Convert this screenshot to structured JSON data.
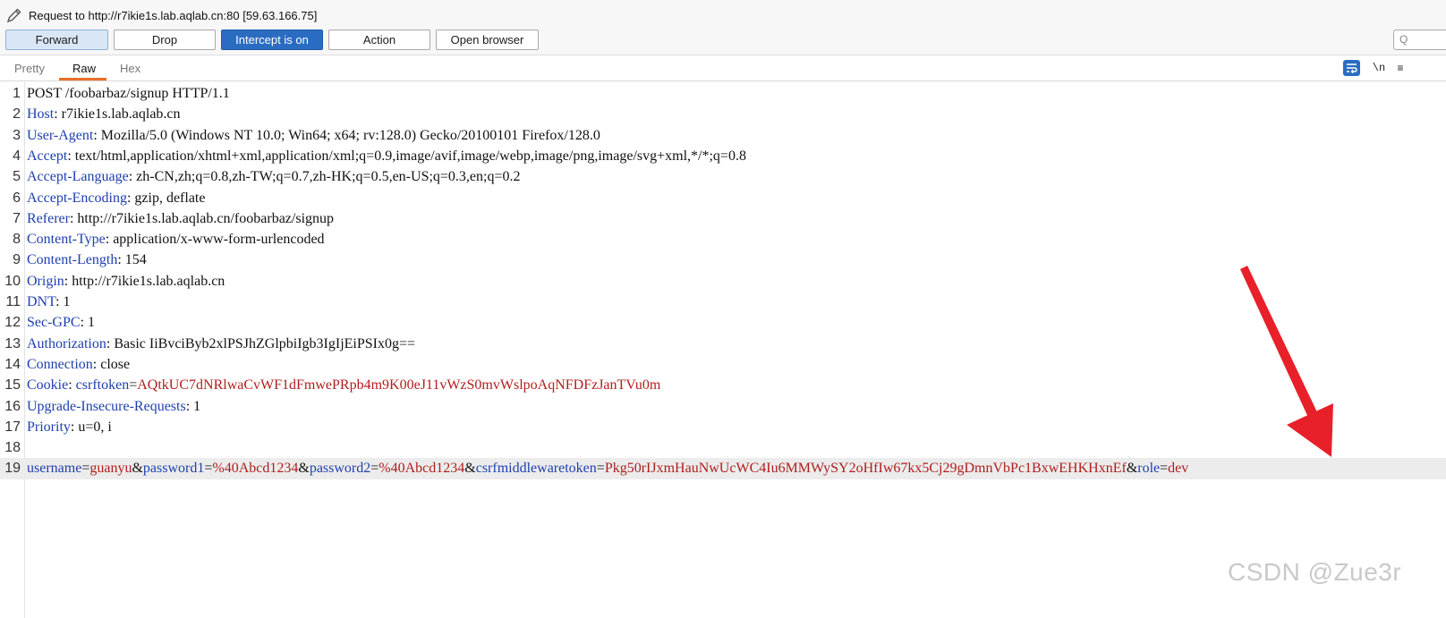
{
  "header": {
    "request_label": "Request to http://r7ikie1s.lab.aqlab.cn:80  [59.63.166.75]"
  },
  "toolbar": {
    "forward": "Forward",
    "drop": "Drop",
    "intercept": "Intercept is on",
    "action": "Action",
    "open_browser": "Open browser",
    "search_stub": "Q"
  },
  "tabs": {
    "pretty": "Pretty",
    "raw": "Raw",
    "hex": "Hex",
    "newline_toggle": "\\n",
    "menu": "≡"
  },
  "request": {
    "lines": [
      {
        "n": "1",
        "parts": [
          {
            "t": "POST /foobarbaz/signup HTTP/1.1",
            "c": "p"
          }
        ]
      },
      {
        "n": "2",
        "parts": [
          {
            "t": "Host",
            "c": "k"
          },
          {
            "t": ": r7ikie1s.lab.aqlab.cn",
            "c": "p"
          }
        ]
      },
      {
        "n": "3",
        "parts": [
          {
            "t": "User-Agent",
            "c": "k"
          },
          {
            "t": ": Mozilla/5.0 (Windows NT 10.0; Win64; x64; rv:128.0) Gecko/20100101 Firefox/128.0",
            "c": "p"
          }
        ]
      },
      {
        "n": "4",
        "parts": [
          {
            "t": "Accept",
            "c": "k"
          },
          {
            "t": ": text/html,application/xhtml+xml,application/xml;q=0.9,image/avif,image/webp,image/png,image/svg+xml,*/*;q=0.8",
            "c": "p"
          }
        ]
      },
      {
        "n": "5",
        "parts": [
          {
            "t": "Accept-Language",
            "c": "k"
          },
          {
            "t": ": zh-CN,zh;q=0.8,zh-TW;q=0.7,zh-HK;q=0.5,en-US;q=0.3,en;q=0.2",
            "c": "p"
          }
        ]
      },
      {
        "n": "6",
        "parts": [
          {
            "t": "Accept-Encoding",
            "c": "k"
          },
          {
            "t": ": gzip, deflate",
            "c": "p"
          }
        ]
      },
      {
        "n": "7",
        "parts": [
          {
            "t": "Referer",
            "c": "k"
          },
          {
            "t": ": http://r7ikie1s.lab.aqlab.cn/foobarbaz/signup",
            "c": "p"
          }
        ]
      },
      {
        "n": "8",
        "parts": [
          {
            "t": "Content-Type",
            "c": "k"
          },
          {
            "t": ": application/x-www-form-urlencoded",
            "c": "p"
          }
        ]
      },
      {
        "n": "9",
        "parts": [
          {
            "t": "Content-Length",
            "c": "k"
          },
          {
            "t": ": 154",
            "c": "p"
          }
        ]
      },
      {
        "n": "10",
        "parts": [
          {
            "t": "Origin",
            "c": "k"
          },
          {
            "t": ": http://r7ikie1s.lab.aqlab.cn",
            "c": "p"
          }
        ]
      },
      {
        "n": "11",
        "parts": [
          {
            "t": "DNT",
            "c": "k"
          },
          {
            "t": ": 1",
            "c": "p"
          }
        ]
      },
      {
        "n": "12",
        "parts": [
          {
            "t": "Sec-GPC",
            "c": "k"
          },
          {
            "t": ": 1",
            "c": "p"
          }
        ]
      },
      {
        "n": "13",
        "parts": [
          {
            "t": "Authorization",
            "c": "k"
          },
          {
            "t": ": Basic IiBvciByb2xlPSJhZGlpbiIgb3IgIjEiPSIx0g==",
            "c": "p"
          }
        ]
      },
      {
        "n": "14",
        "parts": [
          {
            "t": "Connection",
            "c": "k"
          },
          {
            "t": ": close",
            "c": "p"
          }
        ]
      },
      {
        "n": "15",
        "parts": [
          {
            "t": "Cookie",
            "c": "k"
          },
          {
            "t": ": ",
            "c": "p"
          },
          {
            "t": "csrftoken",
            "c": "k"
          },
          {
            "t": "=",
            "c": "p"
          },
          {
            "t": "AQtkUC7dNRlwaCvWF1dFmwePRpb4m9K00eJ11vWzS0mvWslpoAqNFDFzJanTVu0m",
            "c": "v"
          }
        ]
      },
      {
        "n": "16",
        "parts": [
          {
            "t": "Upgrade-Insecure-Requests",
            "c": "k"
          },
          {
            "t": ": 1",
            "c": "p"
          }
        ]
      },
      {
        "n": "17",
        "parts": [
          {
            "t": "Priority",
            "c": "k"
          },
          {
            "t": ": u=0, i",
            "c": "p"
          }
        ]
      },
      {
        "n": "18",
        "parts": []
      },
      {
        "n": "19",
        "hl": true,
        "parts": [
          {
            "t": "username",
            "c": "k"
          },
          {
            "t": "=",
            "c": "p"
          },
          {
            "t": "guanyu",
            "c": "v"
          },
          {
            "t": "&",
            "c": "p"
          },
          {
            "t": "password1",
            "c": "k"
          },
          {
            "t": "=",
            "c": "p"
          },
          {
            "t": "%40Abcd1234",
            "c": "v"
          },
          {
            "t": "&",
            "c": "p"
          },
          {
            "t": "password2",
            "c": "k"
          },
          {
            "t": "=",
            "c": "p"
          },
          {
            "t": "%40Abcd1234",
            "c": "v"
          },
          {
            "t": "&",
            "c": "p"
          },
          {
            "t": "csrfmiddlewaretoken",
            "c": "k"
          },
          {
            "t": "=",
            "c": "p"
          },
          {
            "t": "Pkg50rIJxmHauNwUcWC4Iu6MMWySY2oHfIw67kx5Cj29gDmnVbPc1BxwEHKHxnEf",
            "c": "v"
          },
          {
            "t": "&",
            "c": "p"
          },
          {
            "t": "role",
            "c": "k"
          },
          {
            "t": "=",
            "c": "p"
          },
          {
            "t": "dev",
            "c": "v"
          }
        ]
      }
    ]
  },
  "annotation": {
    "arrow_color": "#e8202a"
  },
  "watermark": "CSDN @Zue3r",
  "colors": {
    "key": "#1f3fae",
    "value": "#b01e1e",
    "accent": "#2a6cc2",
    "tab_underline": "#e8702a"
  }
}
